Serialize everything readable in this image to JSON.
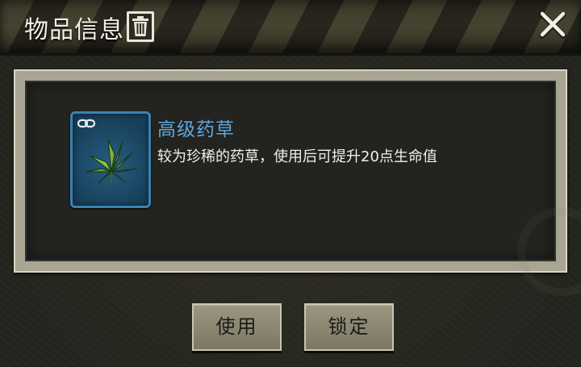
{
  "header": {
    "title": "物品信息",
    "trash_icon": "trash-icon",
    "close_icon": "close-icon"
  },
  "item": {
    "name": "高级药草",
    "description": "较为珍稀的药草，使用后可提升20点生命值",
    "icon": "herb-icon",
    "link_icon": "chain-link-icon"
  },
  "actions": {
    "use_label": "使用",
    "lock_label": "锁定"
  },
  "colors": {
    "item_name": "#5ea7de",
    "slot_border": "#3b82b3",
    "button_face": "#8a8671"
  }
}
